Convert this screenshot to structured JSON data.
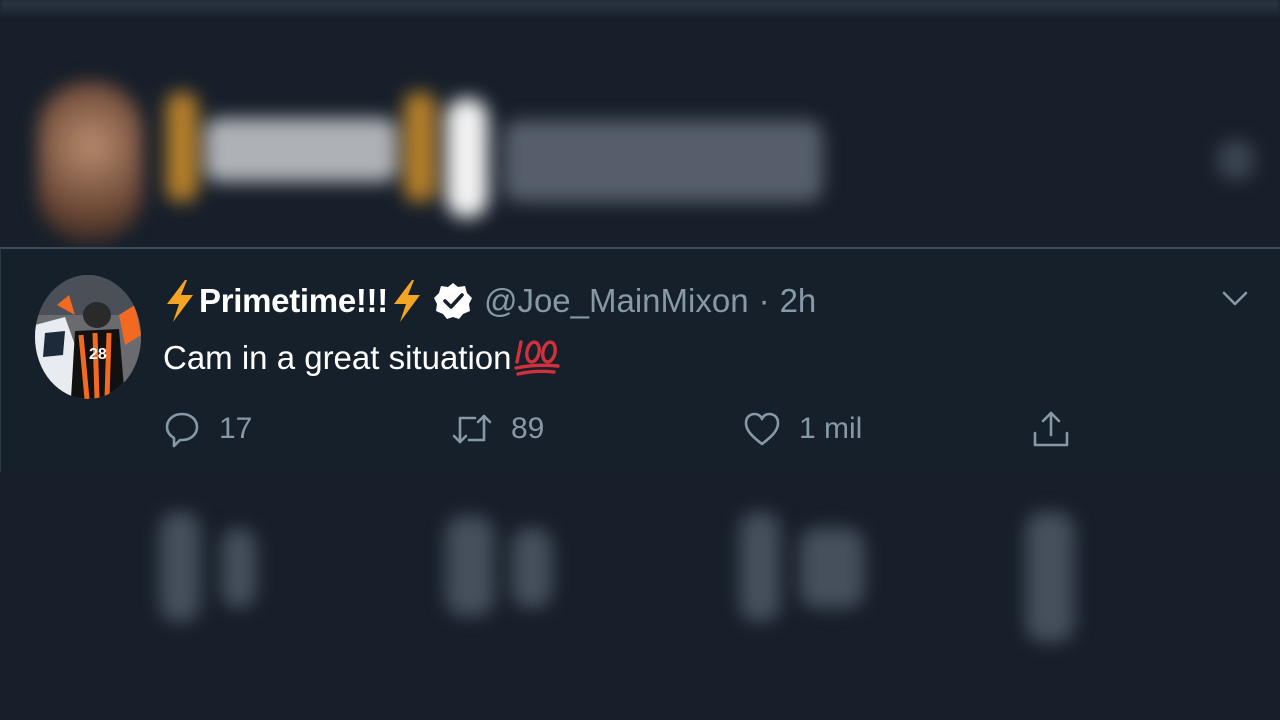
{
  "tweet": {
    "display_name": "Primetime!!!",
    "handle": "@Joe_MainMixon",
    "separator": "·",
    "time": "2h",
    "text": "Cam in a great situation",
    "avatar_jersey_number": "28",
    "stats": {
      "replies": "17",
      "retweets": "89",
      "likes": "1 mil"
    }
  },
  "icons": {
    "name_prefix": "lightning-emoji",
    "name_suffix": "lightning-emoji",
    "verified": "verified-badge-icon",
    "text_suffix": "hundred-points-emoji",
    "menu": "chevron-down-icon",
    "reply": "reply-icon",
    "retweet": "retweet-icon",
    "like": "heart-icon",
    "share": "share-icon"
  },
  "colors": {
    "background": "#15202b",
    "primary_text": "#ffffff",
    "secondary_text": "#8899a6",
    "bolt": "#f4a523",
    "hundred": "#d0313d"
  }
}
